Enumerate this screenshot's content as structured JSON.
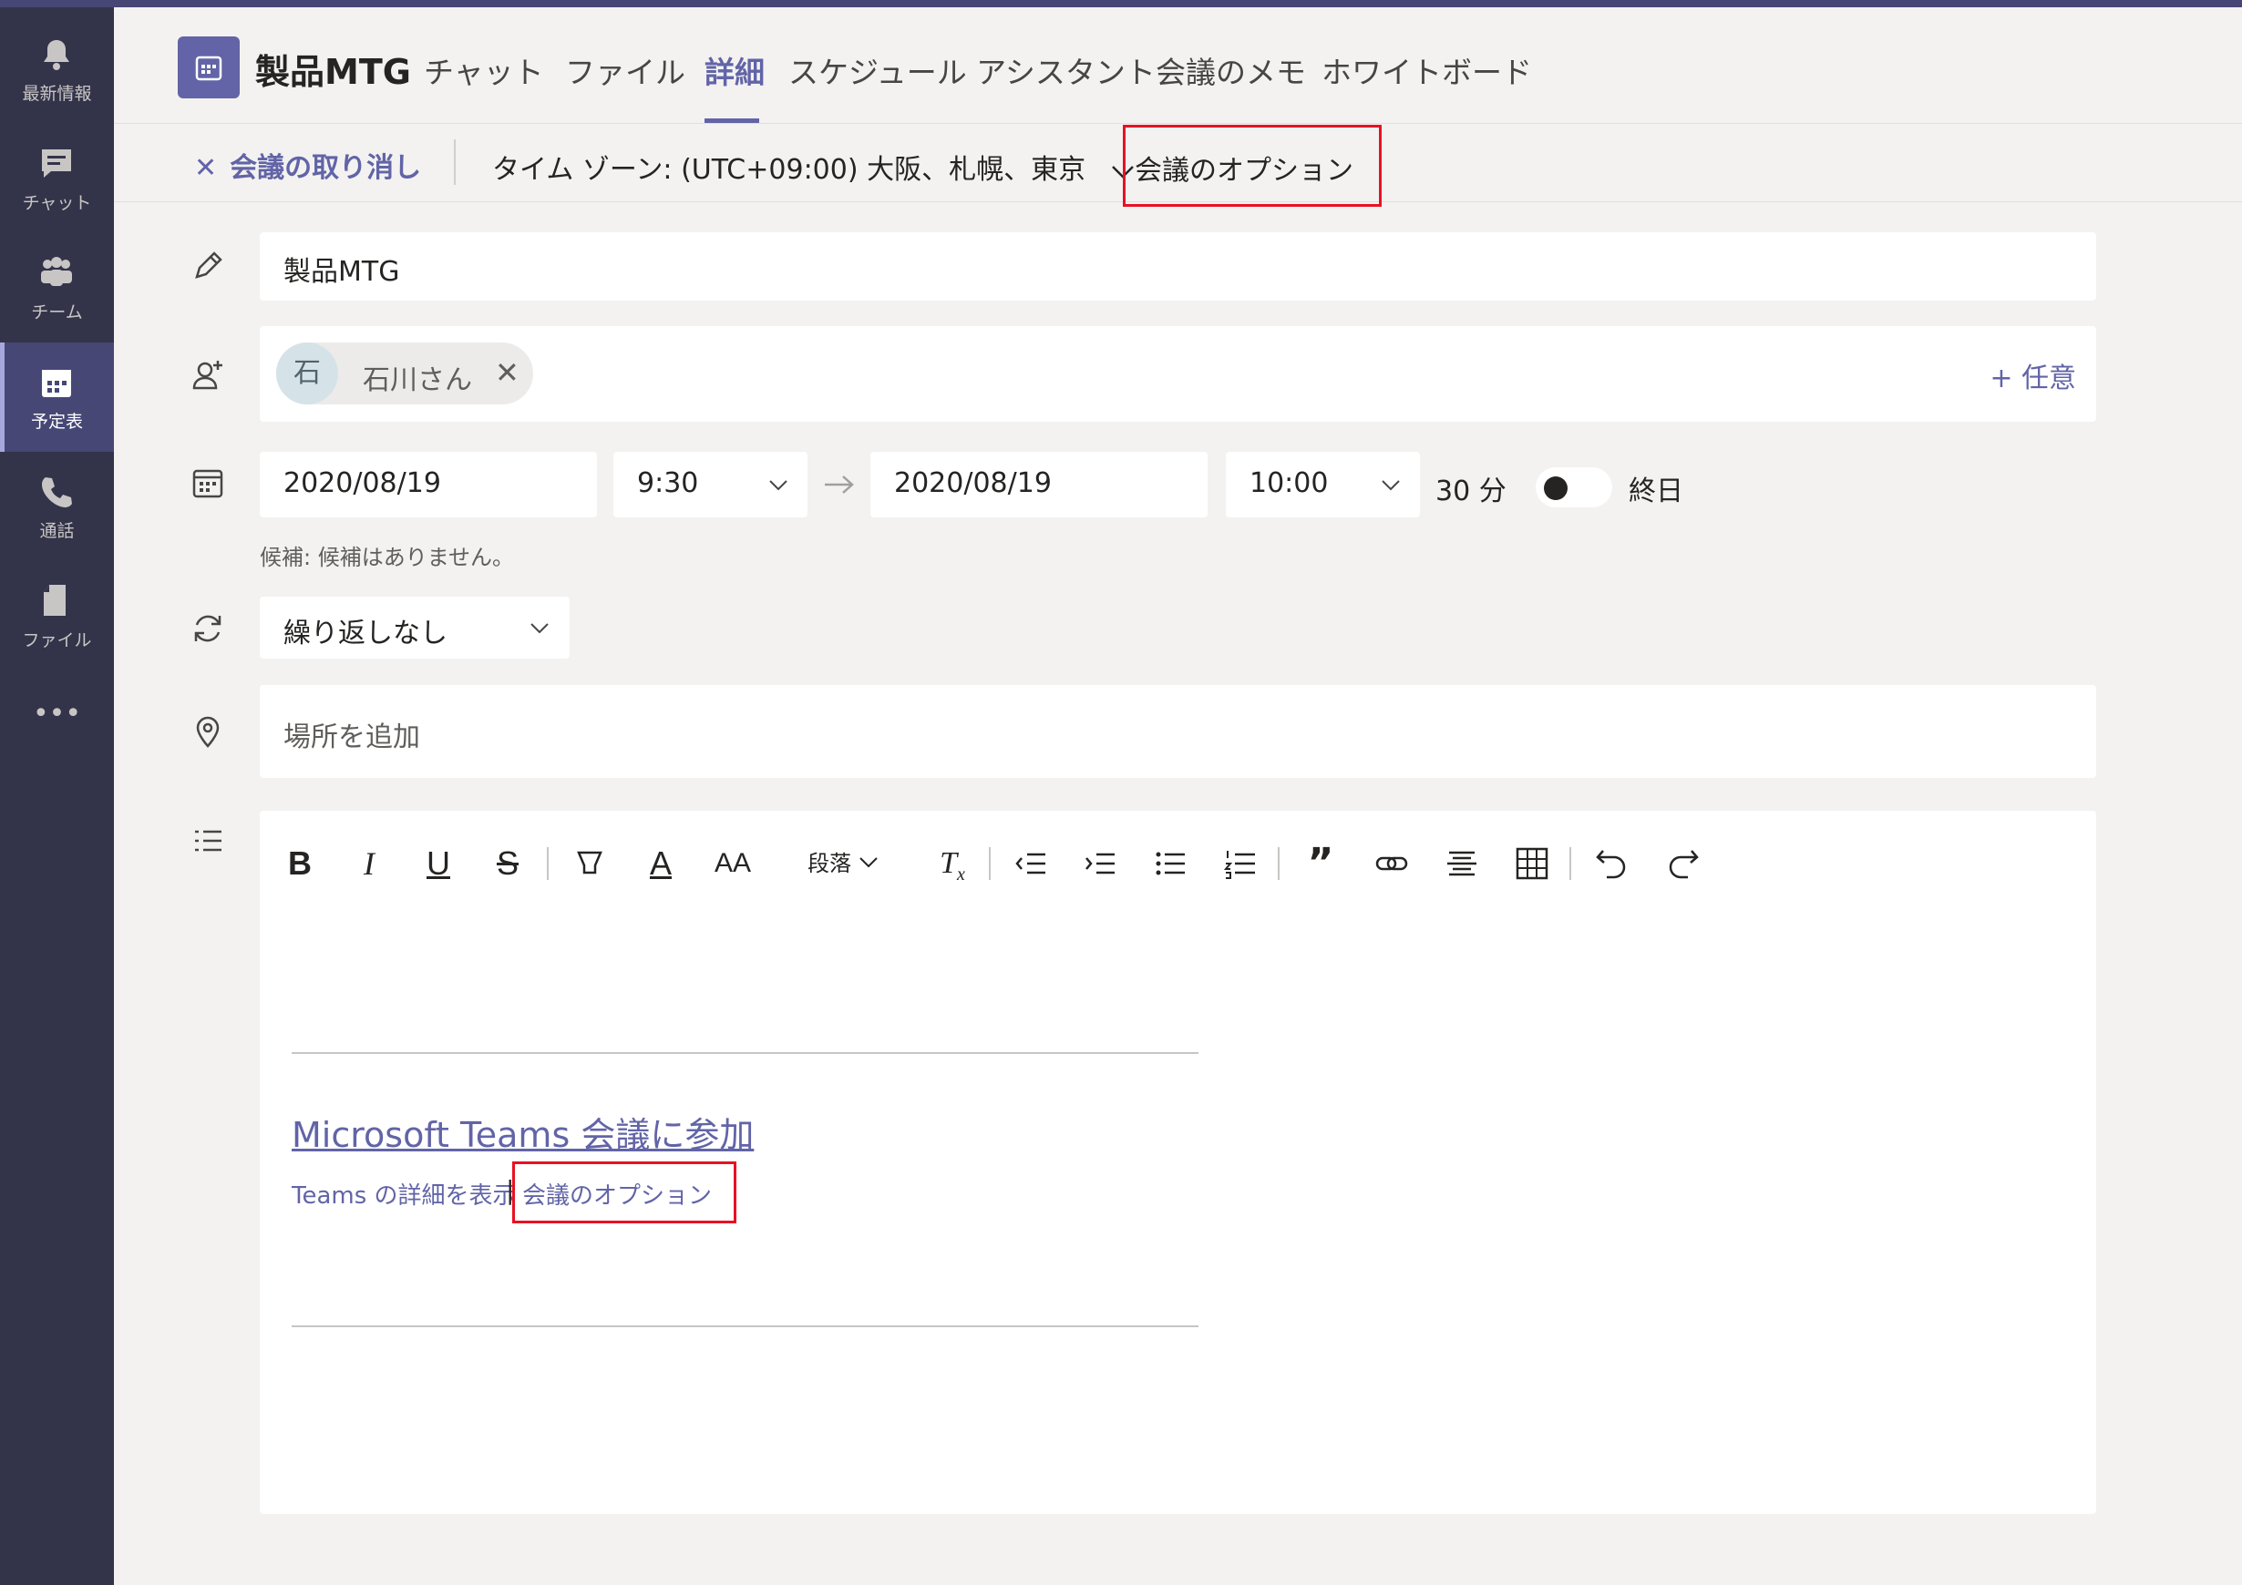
{
  "rail": [
    {
      "label": "最新情報",
      "icon": "bell-icon"
    },
    {
      "label": "チャット",
      "icon": "chat-icon"
    },
    {
      "label": "チーム",
      "icon": "teams-icon"
    },
    {
      "label": "予定表",
      "icon": "calendar-icon",
      "active": true
    },
    {
      "label": "通話",
      "icon": "phone-icon"
    },
    {
      "label": "ファイル",
      "icon": "file-icon"
    },
    {
      "label": "•••",
      "icon": "more-icon"
    }
  ],
  "header": {
    "title": "製品MTG",
    "tabs": [
      "チャット",
      "ファイル",
      "詳細",
      "スケジュール アシスタント",
      "会議のメモ",
      "ホワイトボード"
    ],
    "active_tab": "詳細"
  },
  "command_bar": {
    "cancel_label": "会議の取り消し",
    "timezone_label": "タイム ゾーン: (UTC+09:00) 大阪、札幌、東京",
    "options_label": "会議のオプション"
  },
  "form": {
    "title_value": "製品MTG",
    "attendee": {
      "initial": "石",
      "name": "石川さん"
    },
    "optional_label": "+ 任意",
    "start_date": "2020/08/19",
    "start_time": "9:30",
    "end_date": "2020/08/19",
    "end_time": "10:00",
    "duration": "30 分",
    "all_day_label": "終日",
    "all_day": false,
    "suggestion": "候補: 候補はありません。",
    "recurrence": "繰り返しなし",
    "location_placeholder": "場所を追加"
  },
  "editor": {
    "paragraph_label": "段落",
    "join_link": "Microsoft Teams 会議に参加",
    "details_link": "Teams の詳細を表示",
    "separator": "|",
    "options_link": "会議のオプション"
  },
  "colors": {
    "accent": "#6264a7",
    "rail": "#33344a",
    "highlight_box": "#e81123"
  }
}
